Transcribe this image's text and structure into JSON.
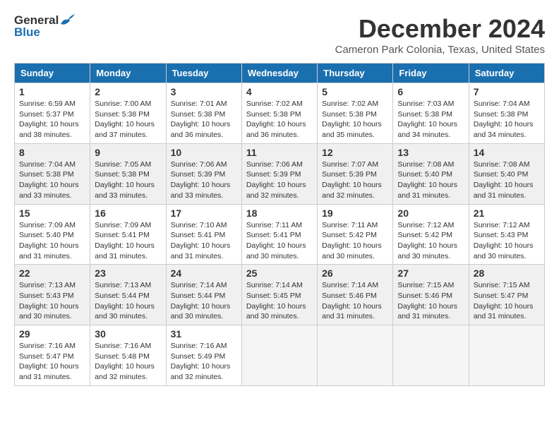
{
  "logo": {
    "general": "General",
    "blue": "Blue"
  },
  "header": {
    "title": "December 2024",
    "subtitle": "Cameron Park Colonia, Texas, United States"
  },
  "weekdays": [
    "Sunday",
    "Monday",
    "Tuesday",
    "Wednesday",
    "Thursday",
    "Friday",
    "Saturday"
  ],
  "weeks": [
    [
      {
        "day": "1",
        "sunrise": "Sunrise: 6:59 AM",
        "sunset": "Sunset: 5:37 PM",
        "daylight": "Daylight: 10 hours and 38 minutes."
      },
      {
        "day": "2",
        "sunrise": "Sunrise: 7:00 AM",
        "sunset": "Sunset: 5:38 PM",
        "daylight": "Daylight: 10 hours and 37 minutes."
      },
      {
        "day": "3",
        "sunrise": "Sunrise: 7:01 AM",
        "sunset": "Sunset: 5:38 PM",
        "daylight": "Daylight: 10 hours and 36 minutes."
      },
      {
        "day": "4",
        "sunrise": "Sunrise: 7:02 AM",
        "sunset": "Sunset: 5:38 PM",
        "daylight": "Daylight: 10 hours and 36 minutes."
      },
      {
        "day": "5",
        "sunrise": "Sunrise: 7:02 AM",
        "sunset": "Sunset: 5:38 PM",
        "daylight": "Daylight: 10 hours and 35 minutes."
      },
      {
        "day": "6",
        "sunrise": "Sunrise: 7:03 AM",
        "sunset": "Sunset: 5:38 PM",
        "daylight": "Daylight: 10 hours and 34 minutes."
      },
      {
        "day": "7",
        "sunrise": "Sunrise: 7:04 AM",
        "sunset": "Sunset: 5:38 PM",
        "daylight": "Daylight: 10 hours and 34 minutes."
      }
    ],
    [
      {
        "day": "8",
        "sunrise": "Sunrise: 7:04 AM",
        "sunset": "Sunset: 5:38 PM",
        "daylight": "Daylight: 10 hours and 33 minutes."
      },
      {
        "day": "9",
        "sunrise": "Sunrise: 7:05 AM",
        "sunset": "Sunset: 5:38 PM",
        "daylight": "Daylight: 10 hours and 33 minutes."
      },
      {
        "day": "10",
        "sunrise": "Sunrise: 7:06 AM",
        "sunset": "Sunset: 5:39 PM",
        "daylight": "Daylight: 10 hours and 33 minutes."
      },
      {
        "day": "11",
        "sunrise": "Sunrise: 7:06 AM",
        "sunset": "Sunset: 5:39 PM",
        "daylight": "Daylight: 10 hours and 32 minutes."
      },
      {
        "day": "12",
        "sunrise": "Sunrise: 7:07 AM",
        "sunset": "Sunset: 5:39 PM",
        "daylight": "Daylight: 10 hours and 32 minutes."
      },
      {
        "day": "13",
        "sunrise": "Sunrise: 7:08 AM",
        "sunset": "Sunset: 5:40 PM",
        "daylight": "Daylight: 10 hours and 31 minutes."
      },
      {
        "day": "14",
        "sunrise": "Sunrise: 7:08 AM",
        "sunset": "Sunset: 5:40 PM",
        "daylight": "Daylight: 10 hours and 31 minutes."
      }
    ],
    [
      {
        "day": "15",
        "sunrise": "Sunrise: 7:09 AM",
        "sunset": "Sunset: 5:40 PM",
        "daylight": "Daylight: 10 hours and 31 minutes."
      },
      {
        "day": "16",
        "sunrise": "Sunrise: 7:09 AM",
        "sunset": "Sunset: 5:41 PM",
        "daylight": "Daylight: 10 hours and 31 minutes."
      },
      {
        "day": "17",
        "sunrise": "Sunrise: 7:10 AM",
        "sunset": "Sunset: 5:41 PM",
        "daylight": "Daylight: 10 hours and 31 minutes."
      },
      {
        "day": "18",
        "sunrise": "Sunrise: 7:11 AM",
        "sunset": "Sunset: 5:41 PM",
        "daylight": "Daylight: 10 hours and 30 minutes."
      },
      {
        "day": "19",
        "sunrise": "Sunrise: 7:11 AM",
        "sunset": "Sunset: 5:42 PM",
        "daylight": "Daylight: 10 hours and 30 minutes."
      },
      {
        "day": "20",
        "sunrise": "Sunrise: 7:12 AM",
        "sunset": "Sunset: 5:42 PM",
        "daylight": "Daylight: 10 hours and 30 minutes."
      },
      {
        "day": "21",
        "sunrise": "Sunrise: 7:12 AM",
        "sunset": "Sunset: 5:43 PM",
        "daylight": "Daylight: 10 hours and 30 minutes."
      }
    ],
    [
      {
        "day": "22",
        "sunrise": "Sunrise: 7:13 AM",
        "sunset": "Sunset: 5:43 PM",
        "daylight": "Daylight: 10 hours and 30 minutes."
      },
      {
        "day": "23",
        "sunrise": "Sunrise: 7:13 AM",
        "sunset": "Sunset: 5:44 PM",
        "daylight": "Daylight: 10 hours and 30 minutes."
      },
      {
        "day": "24",
        "sunrise": "Sunrise: 7:14 AM",
        "sunset": "Sunset: 5:44 PM",
        "daylight": "Daylight: 10 hours and 30 minutes."
      },
      {
        "day": "25",
        "sunrise": "Sunrise: 7:14 AM",
        "sunset": "Sunset: 5:45 PM",
        "daylight": "Daylight: 10 hours and 30 minutes."
      },
      {
        "day": "26",
        "sunrise": "Sunrise: 7:14 AM",
        "sunset": "Sunset: 5:46 PM",
        "daylight": "Daylight: 10 hours and 31 minutes."
      },
      {
        "day": "27",
        "sunrise": "Sunrise: 7:15 AM",
        "sunset": "Sunset: 5:46 PM",
        "daylight": "Daylight: 10 hours and 31 minutes."
      },
      {
        "day": "28",
        "sunrise": "Sunrise: 7:15 AM",
        "sunset": "Sunset: 5:47 PM",
        "daylight": "Daylight: 10 hours and 31 minutes."
      }
    ],
    [
      {
        "day": "29",
        "sunrise": "Sunrise: 7:16 AM",
        "sunset": "Sunset: 5:47 PM",
        "daylight": "Daylight: 10 hours and 31 minutes."
      },
      {
        "day": "30",
        "sunrise": "Sunrise: 7:16 AM",
        "sunset": "Sunset: 5:48 PM",
        "daylight": "Daylight: 10 hours and 32 minutes."
      },
      {
        "day": "31",
        "sunrise": "Sunrise: 7:16 AM",
        "sunset": "Sunset: 5:49 PM",
        "daylight": "Daylight: 10 hours and 32 minutes."
      },
      null,
      null,
      null,
      null
    ]
  ]
}
